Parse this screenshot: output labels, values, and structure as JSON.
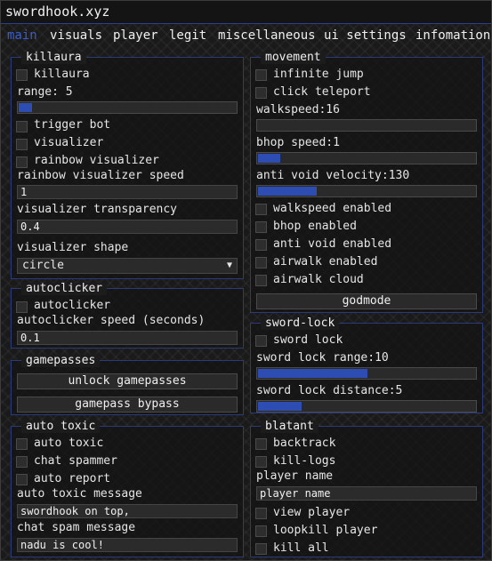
{
  "window": {
    "title": "swordhook.xyz"
  },
  "tabs": [
    "main",
    "visuals",
    "player",
    "legit",
    "miscellaneous",
    "ui settings",
    "infomation"
  ],
  "killaura": {
    "title": "killaura",
    "killaura": "killaura",
    "range_label": "range:",
    "range_value": "5",
    "range_fraction": 0.06,
    "trigger_bot": "trigger bot",
    "visualizer": "visualizer",
    "rainbow_visualizer": "rainbow visualizer",
    "rainbow_speed_label": "rainbow visualizer speed",
    "rainbow_speed_value": "1",
    "transparency_label": "visualizer transparency",
    "transparency_value": "0.4",
    "shape_label": "visualizer shape",
    "shape_value": "circle"
  },
  "autoclicker": {
    "title": "autoclicker",
    "autoclicker": "autoclicker",
    "speed_label": "autoclicker speed (seconds)",
    "speed_value": "0.1"
  },
  "gamepasses": {
    "title": "gamepasses",
    "unlock": "unlock gamepasses",
    "bypass": "gamepass bypass"
  },
  "auto_toxic": {
    "title": "auto toxic",
    "auto_toxic": "auto toxic",
    "chat_spammer": "chat spammer",
    "auto_report": "auto report",
    "message_label": "auto toxic message",
    "message_value": "swordhook on top,",
    "spam_label": "chat spam message",
    "spam_value": "nadu is cool!"
  },
  "movement": {
    "title": "movement",
    "infinite_jump": "infinite jump",
    "click_teleport": "click teleport",
    "walkspeed_label": "walkspeed:",
    "walkspeed_value": "16",
    "walkspeed_fraction": 0.0,
    "bhop_label": "bhop speed:",
    "bhop_value": "1",
    "bhop_fraction": 0.1,
    "antivoid_label": "anti void velocity:",
    "antivoid_value": "130",
    "antivoid_fraction": 0.27,
    "walkspeed_enabled": "walkspeed enabled",
    "bhop_enabled": "bhop enabled",
    "antivoid_enabled": "anti void enabled",
    "airwalk_enabled": "airwalk enabled",
    "airwalk_cloud": "airwalk cloud",
    "godmode": "godmode"
  },
  "sword_lock": {
    "title": "sword-lock",
    "sword_lock": "sword lock",
    "range_label": "sword lock range:",
    "range_value": "10",
    "range_fraction": 0.5,
    "distance_label": "sword lock distance:",
    "distance_value": "5",
    "distance_fraction": 0.2
  },
  "blatant": {
    "title": "blatant",
    "backtrack": "backtrack",
    "kill_logs": "kill-logs",
    "player_name_label": "player name",
    "player_name_value": "player name",
    "view_player": "view player",
    "loopkill_player": "loopkill player",
    "kill_all": "kill all"
  },
  "colors": {
    "accent": "#2e4db3",
    "border": "#2b3b7a",
    "active_tab": "#3a5dcc"
  }
}
